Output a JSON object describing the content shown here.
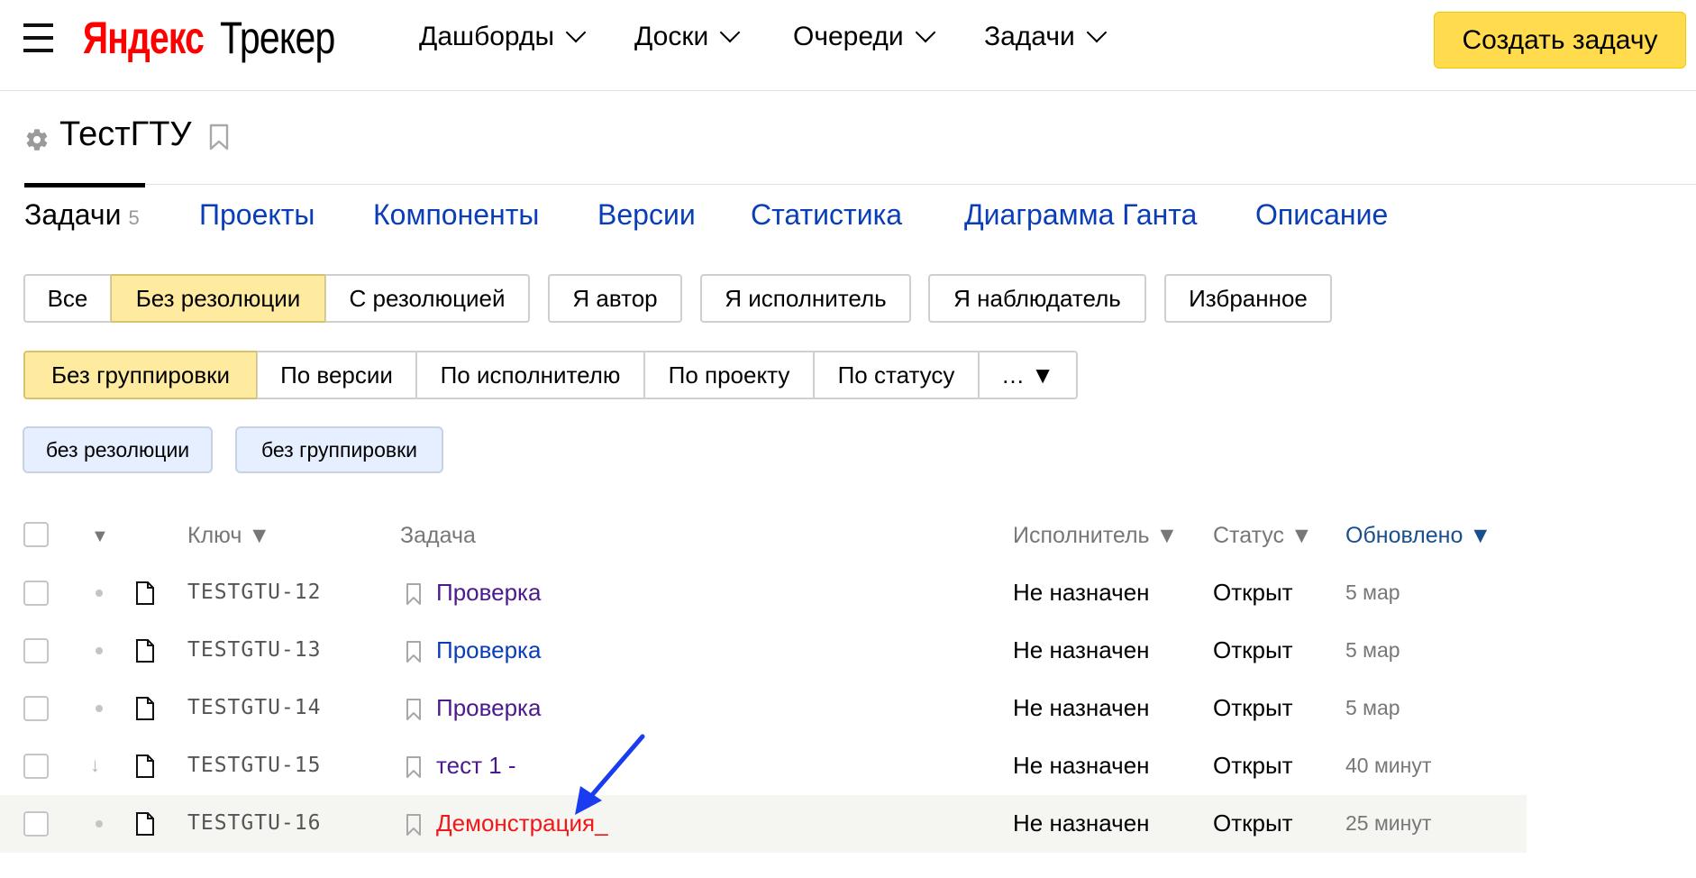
{
  "header": {
    "logo_brand": "Яндекс",
    "logo_product": "Трекер",
    "nav": [
      {
        "label": "Дашборды"
      },
      {
        "label": "Доски"
      },
      {
        "label": "Очереди"
      },
      {
        "label": "Задачи"
      }
    ],
    "create_label": "Создать задачу"
  },
  "queue": {
    "title": "ТестГТУ"
  },
  "tabs": [
    {
      "label": "Задачи",
      "count": "5"
    },
    {
      "label": "Проекты"
    },
    {
      "label": "Компоненты"
    },
    {
      "label": "Версии"
    },
    {
      "label": "Статистика"
    },
    {
      "label": "Диаграмма Ганта"
    },
    {
      "label": "Описание"
    }
  ],
  "filters": {
    "resolution": [
      "Все",
      "Без резолюции",
      "С резолюцией"
    ],
    "role": [
      "Я автор",
      "Я исполнитель",
      "Я наблюдатель",
      "Избранное"
    ]
  },
  "grouping": [
    "Без группировки",
    "По версии",
    "По исполнителю",
    "По проекту",
    "По статусу",
    "… ▼"
  ],
  "active_tags": [
    "без резолюции",
    "без группировки"
  ],
  "table": {
    "headers": {
      "priority": "▼",
      "key": "Ключ ▼",
      "summary": "Задача",
      "assignee": "Исполнитель ▼",
      "status": "Статус ▼",
      "updated": "Обновлено ▼"
    },
    "rows": [
      {
        "key": "TESTGTU-12",
        "summary": "Проверка",
        "assignee": "Не назначен",
        "status": "Открыт",
        "updated": "5 мар",
        "priority": "normal",
        "link_color": "#4b1a8c"
      },
      {
        "key": "TESTGTU-13",
        "summary": "Проверка",
        "assignee": "Не назначен",
        "status": "Открыт",
        "updated": "5 мар",
        "priority": "normal",
        "link_color": "#0a3eb8"
      },
      {
        "key": "TESTGTU-14",
        "summary": "Проверка",
        "assignee": "Не назначен",
        "status": "Открыт",
        "updated": "5 мар",
        "priority": "normal",
        "link_color": "#4b1a8c"
      },
      {
        "key": "TESTGTU-15",
        "summary": "тест 1 -",
        "assignee": "Не назначен",
        "status": "Открыт",
        "updated": "40 минут",
        "priority": "low",
        "link_color": "#4b1a8c"
      },
      {
        "key": "TESTGTU-16",
        "summary": "Демонстрация_",
        "assignee": "Не назначен",
        "status": "Открыт",
        "updated": "25 минут",
        "priority": "normal",
        "link_color": "#f01818"
      }
    ]
  },
  "colors": {
    "accent_yellow": "#ffdb4d",
    "link_blue": "#0a3eb8",
    "visited_purple": "#4b1a8c",
    "hover_red": "#f01818",
    "annotation_arrow": "#1a3cf0"
  }
}
